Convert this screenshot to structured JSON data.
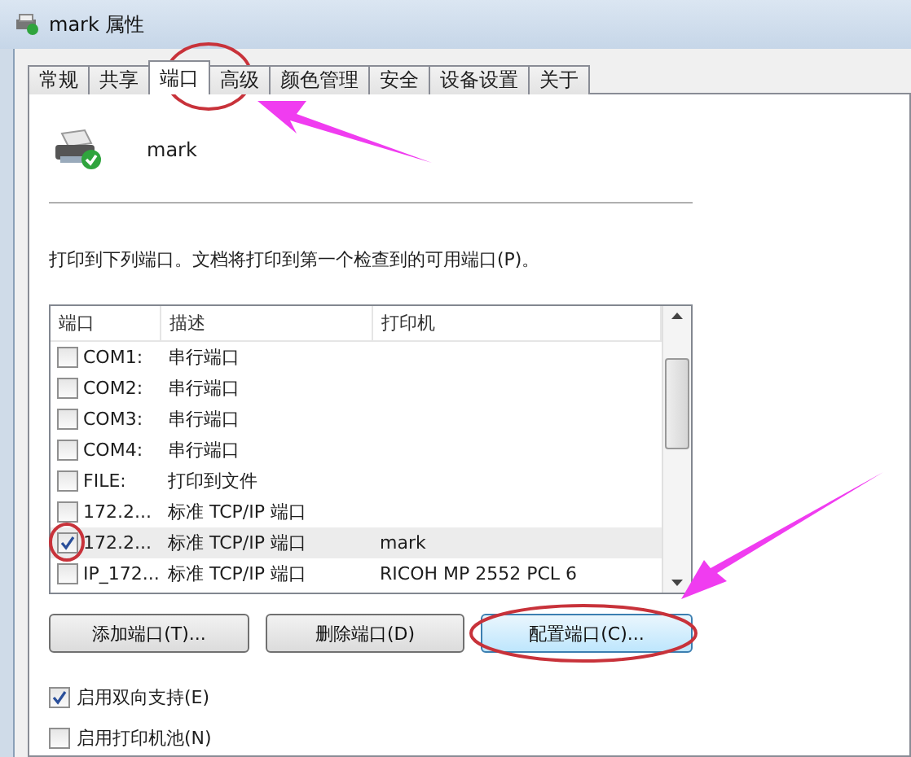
{
  "window": {
    "title": "mark 属性"
  },
  "tabs": [
    {
      "label": "常规",
      "selected": false
    },
    {
      "label": "共享",
      "selected": false
    },
    {
      "label": "端口",
      "selected": true
    },
    {
      "label": "高级",
      "selected": false
    },
    {
      "label": "颜色管理",
      "selected": false
    },
    {
      "label": "安全",
      "selected": false
    },
    {
      "label": "设备设置",
      "selected": false
    },
    {
      "label": "关于",
      "selected": false
    }
  ],
  "printer_name": "mark",
  "instruction": "打印到下列端口。文档将打印到第一个检查到的可用端口(P)。",
  "ports": {
    "columns": [
      "端口",
      "描述",
      "打印机"
    ],
    "rows": [
      {
        "port": "COM1:",
        "description": "串行端口",
        "printer": "",
        "checked": false,
        "selected": false
      },
      {
        "port": "COM2:",
        "description": "串行端口",
        "printer": "",
        "checked": false,
        "selected": false
      },
      {
        "port": "COM3:",
        "description": "串行端口",
        "printer": "",
        "checked": false,
        "selected": false
      },
      {
        "port": "COM4:",
        "description": "串行端口",
        "printer": "",
        "checked": false,
        "selected": false
      },
      {
        "port": "FILE:",
        "description": "打印到文件",
        "printer": "",
        "checked": false,
        "selected": false
      },
      {
        "port": "172.2...",
        "description": "标准 TCP/IP 端口",
        "printer": "",
        "checked": false,
        "selected": false
      },
      {
        "port": "172.2...",
        "description": "标准 TCP/IP 端口",
        "printer": "mark",
        "checked": true,
        "selected": true
      },
      {
        "port": "IP_172...",
        "description": "标准 TCP/IP 端口",
        "printer": "RICOH MP 2552 PCL 6",
        "checked": false,
        "selected": false
      }
    ]
  },
  "buttons": [
    {
      "label": "添加端口(T)...",
      "focused": false
    },
    {
      "label": "删除端口(D)",
      "focused": false
    },
    {
      "label": "配置端口(C)...",
      "focused": true
    }
  ],
  "options": [
    {
      "label": "启用双向支持(E)",
      "checked": true
    },
    {
      "label": "启用打印机池(N)",
      "checked": false
    }
  ]
}
